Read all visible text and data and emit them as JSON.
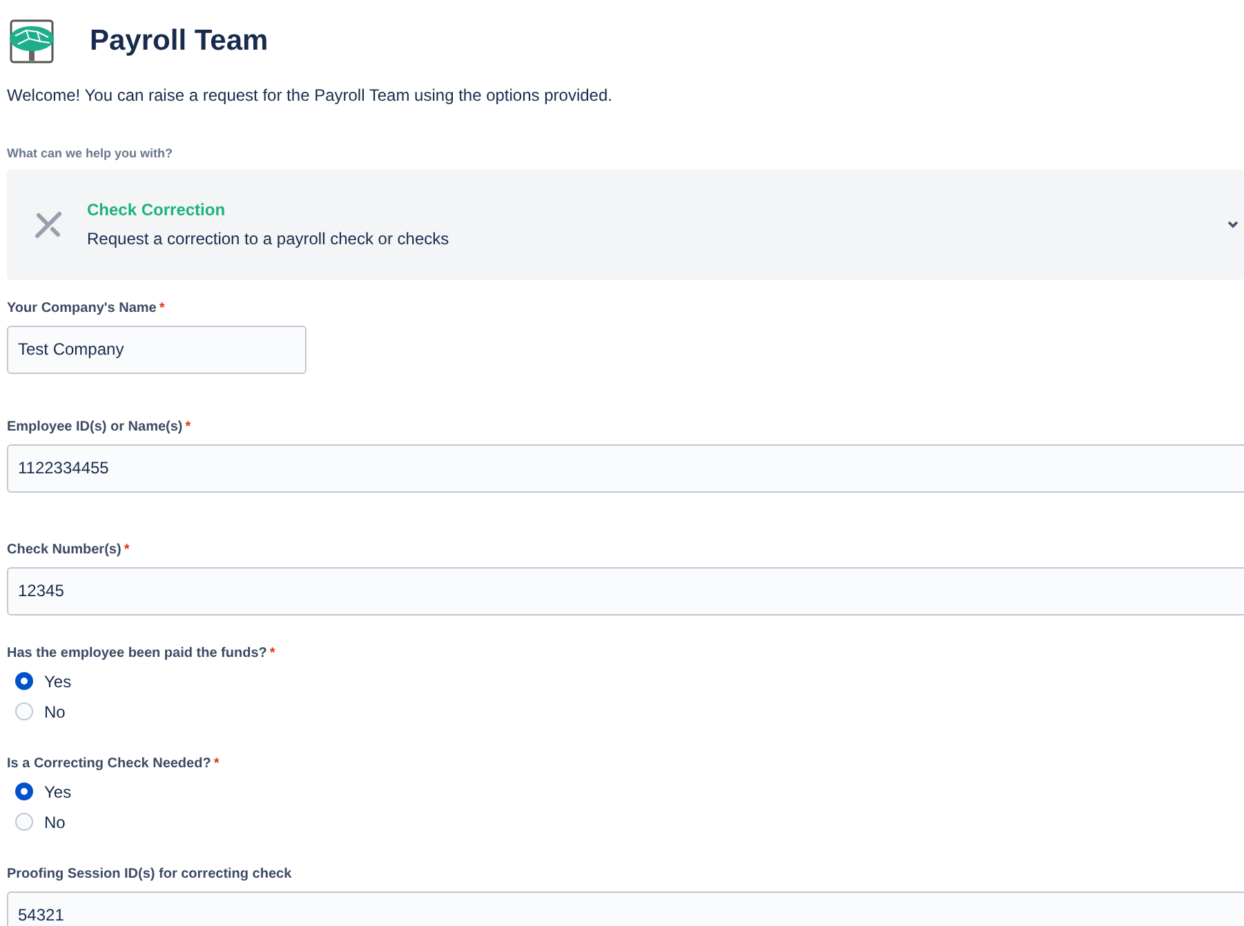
{
  "header": {
    "title": "Payroll Team",
    "welcome": "Welcome! You can raise a request for the Payroll Team using the options provided."
  },
  "request_type": {
    "label": "What can we help you with?",
    "title": "Check Correction",
    "description": "Request a correction to a payroll check or checks"
  },
  "fields": [
    {
      "kind": "short-text",
      "label": "Your Company's Name",
      "required_mark": "*",
      "value": "Test Company"
    },
    {
      "kind": "text",
      "label": "Employee ID(s) or Name(s)",
      "required_mark": "*",
      "value": "1122334455"
    },
    {
      "kind": "text",
      "label": "Check Number(s)",
      "required_mark": "*",
      "value": "12345"
    },
    {
      "kind": "radio",
      "label": "Has the employee been paid the funds?",
      "required_mark": "*",
      "options": [
        {
          "label": "Yes",
          "selected": true
        },
        {
          "label": "No",
          "selected": false
        }
      ]
    },
    {
      "kind": "radio",
      "label": "Is a Correcting Check Needed?",
      "required_mark": "*",
      "options": [
        {
          "label": "Yes",
          "selected": true
        },
        {
          "label": "No",
          "selected": false
        }
      ]
    },
    {
      "kind": "text",
      "label": "Proofing Session ID(s) for correcting check",
      "value": "54321"
    }
  ]
}
